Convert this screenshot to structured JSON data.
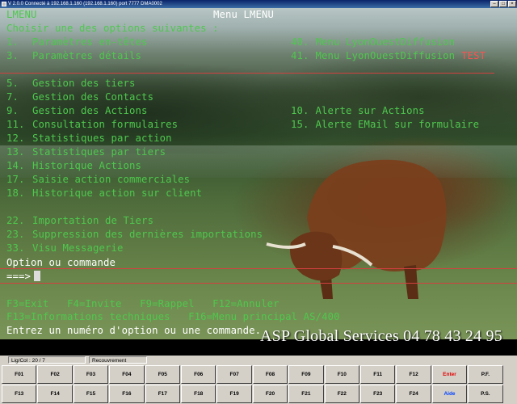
{
  "window": {
    "title": "V 2.0.0 Connecté à 192.168.1.160 (192.168.1.160) port 7777  DMA0002"
  },
  "terminal": {
    "program": "LMENU",
    "menu_title": "Menu LMENU",
    "prompt": "Choisir une des options suivantes :",
    "options_left": [
      {
        "num": "1.",
        "label": "Paramètres en-têtes"
      },
      {
        "num": "3.",
        "label": "Paramètres détails"
      },
      {
        "num": "5.",
        "label": "Gestion des tiers"
      },
      {
        "num": "7.",
        "label": "Gestion des Contacts"
      },
      {
        "num": "9.",
        "label": "Gestion des Actions"
      },
      {
        "num": "11.",
        "label": "Consultation formulaires"
      },
      {
        "num": "12.",
        "label": "Statistiques par action"
      },
      {
        "num": "13.",
        "label": "Statistiques par tiers"
      },
      {
        "num": "14.",
        "label": "Historique Actions"
      },
      {
        "num": "17.",
        "label": "Saisie action commerciales"
      },
      {
        "num": "18.",
        "label": "Historique action sur client"
      },
      {
        "num": "22.",
        "label": "Importation de Tiers"
      },
      {
        "num": "23.",
        "label": "Suppression des dernières importations"
      },
      {
        "num": "33.",
        "label": "Visu Messagerie"
      }
    ],
    "options_right": [
      {
        "num": "40.",
        "label": "Menu LyonOuestDiffusion",
        "suffix": ""
      },
      {
        "num": "41.",
        "label": "Menu LyonOuestDiffusion",
        "suffix": "TEST"
      },
      {
        "num": "10.",
        "label": "Alerte sur Actions",
        "suffix": ""
      },
      {
        "num": "15.",
        "label": "Alerte EMail sur formulaire",
        "suffix": ""
      }
    ],
    "command_label": "Option ou commande",
    "command_arrow": "===>",
    "command_value": "",
    "fkey_line1": "F3=Exit   F4=Invite   F9=Rappel   F12=Annuler",
    "fkey_line2": "F13=Informations techniques   F16=Menu principal AS/400",
    "message": "Entrez un numéro d'option ou une commande."
  },
  "brand": {
    "text": "ASP Global Services  04 78 43 24 95"
  },
  "status": {
    "ligcol": "Lig/Col : 20 / 7",
    "mode": "Recouvrement"
  },
  "keys_row1": [
    "F01",
    "F02",
    "F03",
    "F04",
    "F05",
    "F06",
    "F07",
    "F08",
    "F09",
    "F10",
    "F11",
    "F12",
    "Enter",
    "P.F."
  ],
  "keys_row2": [
    "F13",
    "F14",
    "F15",
    "F16",
    "F17",
    "F18",
    "F19",
    "F20",
    "F21",
    "F22",
    "F23",
    "F24",
    "Aide",
    "P.S."
  ],
  "colors": {
    "terminal_green": "#4ec84e",
    "terminal_white": "#ffffff",
    "test_red": "#ff5050",
    "enter_red": "#e00000",
    "aide_blue": "#0040ff"
  }
}
